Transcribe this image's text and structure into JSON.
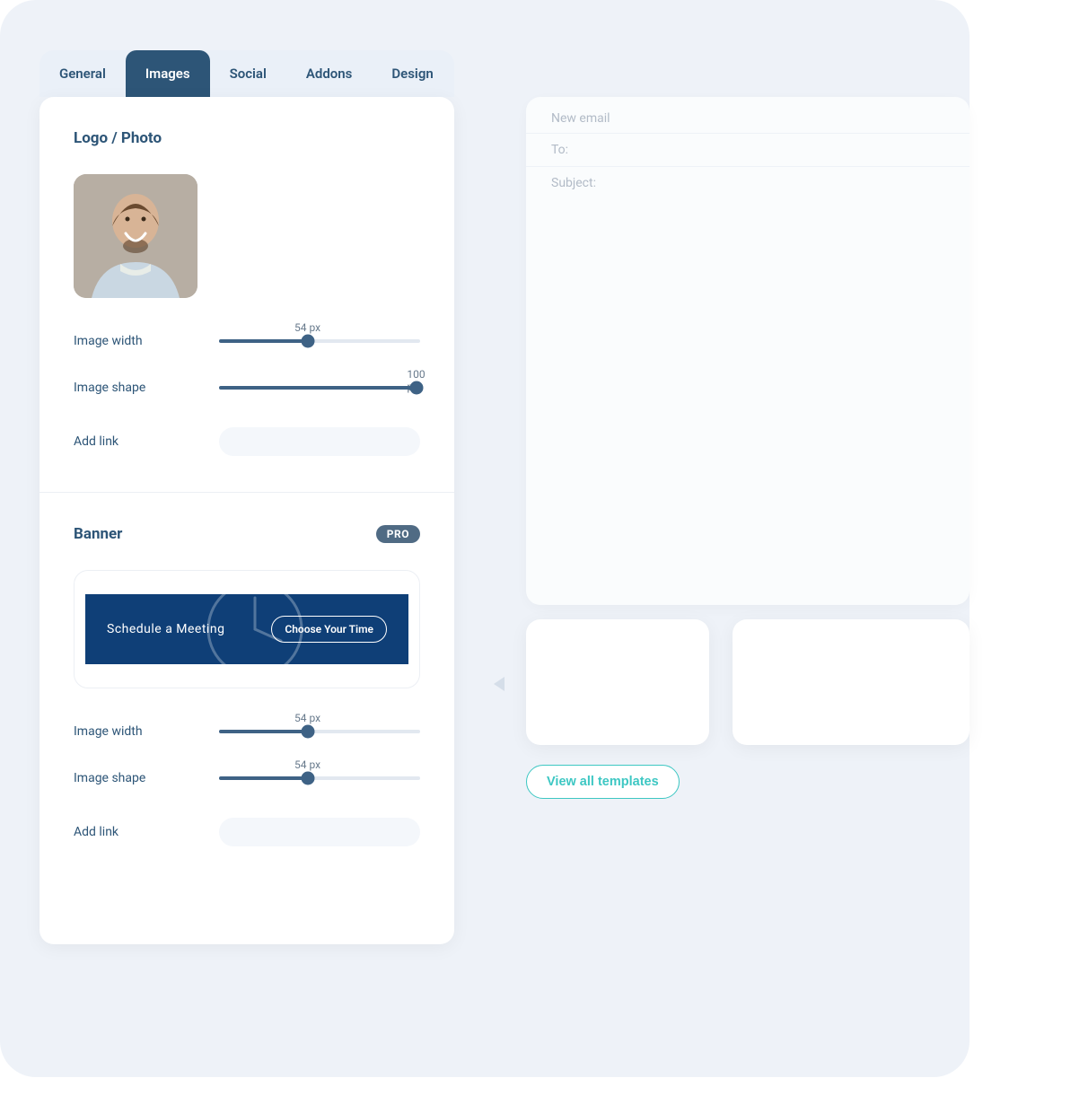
{
  "tabs": [
    {
      "label": "General"
    },
    {
      "label": "Images"
    },
    {
      "label": "Social"
    },
    {
      "label": "Addons"
    },
    {
      "label": "Design"
    }
  ],
  "active_tab_index": 1,
  "logo_section": {
    "title": "Logo / Photo",
    "width_label": "Image width",
    "width_value": "54 px",
    "width_percent": 44,
    "shape_label": "Image shape",
    "shape_value": "100 px",
    "shape_percent": 98,
    "add_link_label": "Add link"
  },
  "banner_section": {
    "title": "Banner",
    "badge": "PRO",
    "banner_text": "Schedule a Meeting",
    "banner_button": "Choose Your Time",
    "width_label": "Image width",
    "width_value": "54 px",
    "width_percent": 44,
    "shape_label": "Image shape",
    "shape_value": "54 px",
    "shape_percent": 44,
    "add_link_label": "Add link"
  },
  "email": {
    "header": "New email",
    "to_label": "To:",
    "subject_label": "Subject:"
  },
  "view_all_label": "View all templates",
  "colors": {
    "navy": "#2d5577",
    "slider": "#3e6285",
    "banner_bg": "#0f3f77",
    "accent": "#3dc7c3",
    "page_bg": "#eef2f8"
  }
}
